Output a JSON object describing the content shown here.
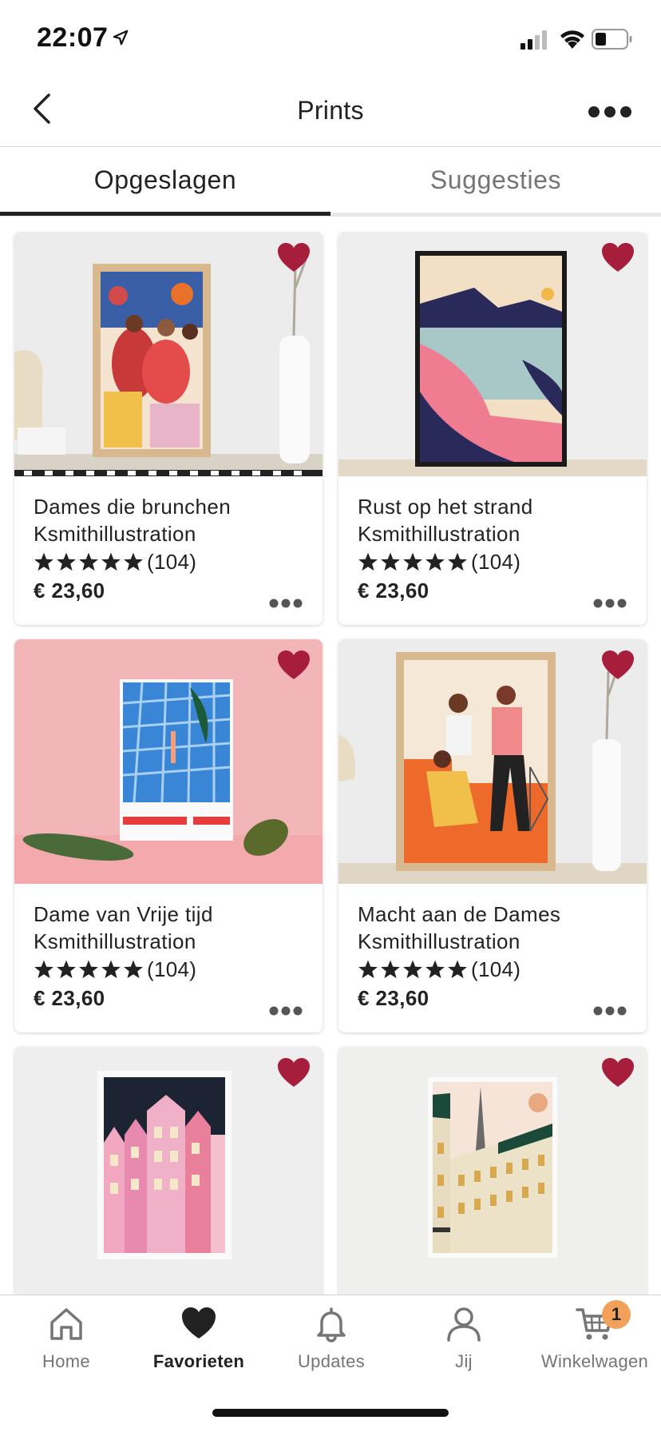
{
  "status_bar": {
    "time": "22:07"
  },
  "nav": {
    "title": "Prints"
  },
  "tabs": [
    {
      "label": "Opgeslagen",
      "active": true
    },
    {
      "label": "Suggesties",
      "active": false
    }
  ],
  "products": [
    {
      "title": "Dames die brunchen",
      "shop": "Ksmithillustration",
      "rating": 5,
      "reviews": "(104)",
      "price": "€ 23,60",
      "favorited": true
    },
    {
      "title": "Rust op het strand",
      "shop": "Ksmithillustration",
      "rating": 5,
      "reviews": "(104)",
      "price": "€ 23,60",
      "favorited": true
    },
    {
      "title": "Dame van Vrije tijd",
      "shop": "Ksmithillustration",
      "rating": 5,
      "reviews": "(104)",
      "price": "€ 23,60",
      "favorited": true
    },
    {
      "title": "Macht aan de Dames",
      "shop": "Ksmithillustration",
      "rating": 5,
      "reviews": "(104)",
      "price": "€ 23,60",
      "favorited": true
    },
    {
      "favorited": true
    },
    {
      "favorited": true
    }
  ],
  "tab_bar": {
    "items": [
      {
        "label": "Home",
        "icon": "home-icon",
        "active": false
      },
      {
        "label": "Favorieten",
        "icon": "heart-icon",
        "active": true
      },
      {
        "label": "Updates",
        "icon": "bell-icon",
        "active": false
      },
      {
        "label": "Jij",
        "icon": "person-icon",
        "active": false
      },
      {
        "label": "Winkelwagen",
        "icon": "cart-icon",
        "active": false,
        "badge": "1"
      }
    ]
  },
  "colors": {
    "favorite": "#a61e3c",
    "badge": "#f1a15a",
    "text": "#222222",
    "muted": "#757575"
  }
}
